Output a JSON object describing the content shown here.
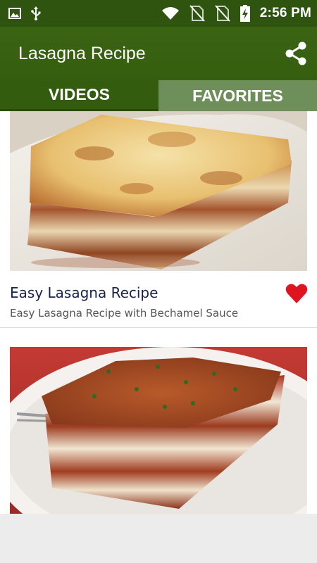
{
  "status_bar": {
    "time": "2:56 PM",
    "icons": [
      "image-icon",
      "usb-icon",
      "wifi-icon",
      "no-sim-icon",
      "no-sim-icon",
      "battery-charging-icon"
    ]
  },
  "app_bar": {
    "title": "Lasagna Recipe",
    "share_icon": "share-icon"
  },
  "tabs": [
    {
      "label": "VIDEOS",
      "active": true
    },
    {
      "label": "FAVORITES",
      "active": false
    }
  ],
  "videos": [
    {
      "title": "Easy Lasagna Recipe",
      "subtitle": "Easy Lasagna Recipe with Bechamel Sauce",
      "favorite": true
    },
    {
      "title": "",
      "subtitle": "",
      "favorite": false
    }
  ],
  "colors": {
    "status_bar": "#2e5410",
    "app_bar": "#3a6412",
    "tab_active": "#335c0e",
    "tab_inactive": "#6f8f5a",
    "heart": "#e0141e"
  }
}
